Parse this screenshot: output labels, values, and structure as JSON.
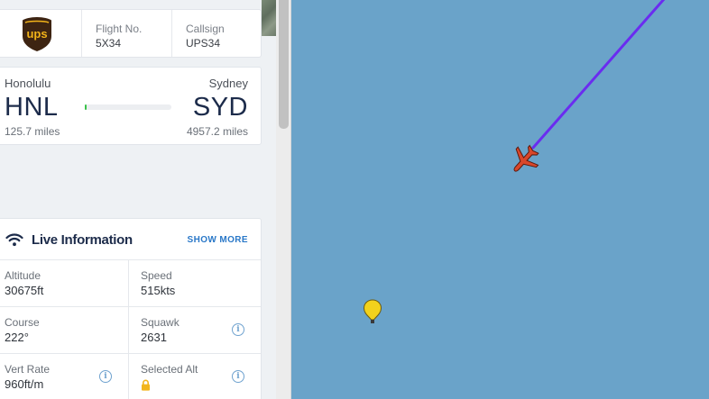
{
  "airline": {
    "logo_text": "ups",
    "flight_no_label": "Flight No.",
    "flight_no": "5X34",
    "callsign_label": "Callsign",
    "callsign": "UPS34"
  },
  "route": {
    "origin_city": "Honolulu",
    "origin_code": "HNL",
    "origin_distance": "125.7 miles",
    "destination_city": "Sydney",
    "destination_code": "SYD",
    "destination_distance": "4957.2 miles",
    "progress_fraction": 0.025,
    "progress_color": "#39c24a"
  },
  "live": {
    "title": "Live Information",
    "show_more": "SHOW MORE",
    "icon": "wifi-icon",
    "altitude_label": "Altitude",
    "altitude": "30675ft",
    "speed_label": "Speed",
    "speed": "515kts",
    "course_label": "Course",
    "course": "222°",
    "squawk_label": "Squawk",
    "squawk": "2631",
    "vert_rate_label": "Vert Rate",
    "vert_rate": "960ft/m",
    "selected_alt_label": "Selected Alt",
    "info_icon_glyph": "i"
  },
  "map": {
    "water_color": "#6aa3c9",
    "track_color": "#6a2cf0",
    "plane_color": "#d9472b",
    "marker_color": "#f2d21c"
  }
}
